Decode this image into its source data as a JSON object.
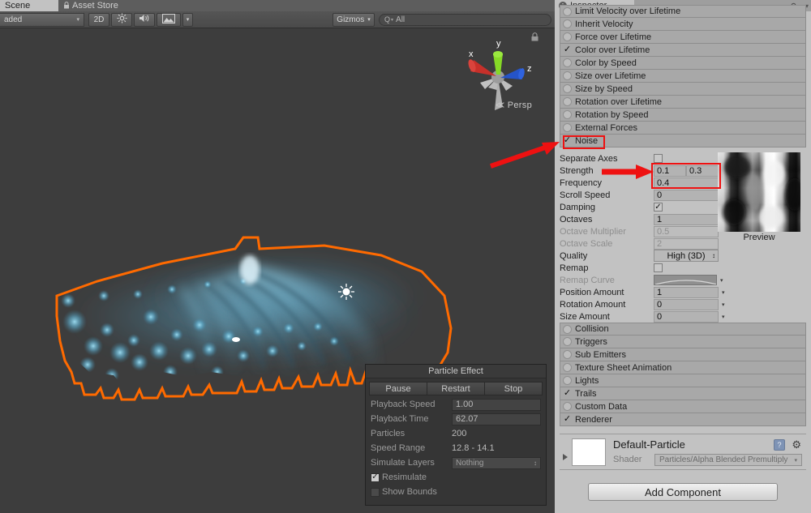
{
  "scene_tabs": [
    {
      "label": "Scene",
      "active": true,
      "icon": ""
    },
    {
      "label": "Asset Store",
      "active": false,
      "icon": "lock-icon"
    }
  ],
  "scene_toolbar": {
    "draw_mode": "aded",
    "mode_2d": "2D",
    "lighting_icon": "sun-icon",
    "audio_icon": "speaker-icon",
    "fx_icon": "image-icon",
    "fx_caret": "▾",
    "gizmos_label": "Gizmos",
    "gizmos_caret": "▾",
    "search_prefix": "Q",
    "search_caret": "▾",
    "search_value": "All",
    "search_placeholder": "All"
  },
  "viewport": {
    "gizmo": {
      "axis_x": "x",
      "axis_y": "y",
      "axis_z": "z",
      "projection": "Persp",
      "projection_arrow": "≪",
      "lock_icon": "lock-icon"
    }
  },
  "particle_effect": {
    "title": "Particle Effect",
    "buttons": [
      "Pause",
      "Restart",
      "Stop"
    ],
    "rows": [
      {
        "label": "Playback Speed",
        "value": "1.00",
        "kind": "field"
      },
      {
        "label": "Playback Time",
        "value": "62.07",
        "kind": "field"
      },
      {
        "label": "Particles",
        "value": "200",
        "kind": "text"
      },
      {
        "label": "Speed Range",
        "value": "12.8 - 14.1",
        "kind": "text"
      },
      {
        "label": "Simulate Layers",
        "value": "Nothing",
        "kind": "dropdown"
      }
    ],
    "checkboxes": [
      {
        "label": "Resimulate",
        "checked": true
      },
      {
        "label": "Show Bounds",
        "checked": false
      }
    ]
  },
  "inspector": {
    "tab_label": "Inspector",
    "info_glyph": "i",
    "lock_icon": "lock-icon",
    "menu_icon": "hamburger-icon",
    "modules_top": [
      {
        "label": "Limit Velocity over Lifetime",
        "checked": false
      },
      {
        "label": "Inherit Velocity",
        "checked": false
      },
      {
        "label": "Force over Lifetime",
        "checked": false
      },
      {
        "label": "Color over Lifetime",
        "checked": true
      },
      {
        "label": "Color by Speed",
        "checked": false
      },
      {
        "label": "Size over Lifetime",
        "checked": false
      },
      {
        "label": "Size by Speed",
        "checked": false
      },
      {
        "label": "Rotation over Lifetime",
        "checked": false
      },
      {
        "label": "Rotation by Speed",
        "checked": false
      },
      {
        "label": "External Forces",
        "checked": false
      },
      {
        "label": "Noise",
        "checked": true
      }
    ],
    "noise": {
      "separate_axes_label": "Separate Axes",
      "separate_axes_checked": false,
      "strength_label": "Strength",
      "strength_min": "0.1",
      "strength_max": "0.3",
      "frequency_label": "Frequency",
      "frequency_value": "0.4",
      "scroll_speed_label": "Scroll Speed",
      "scroll_speed_value": "0",
      "damping_label": "Damping",
      "damping_checked": true,
      "octaves_label": "Octaves",
      "octaves_value": "1",
      "octave_multiplier_label": "Octave Multiplier",
      "octave_multiplier_value": "0.5",
      "octave_scale_label": "Octave Scale",
      "octave_scale_value": "2",
      "quality_label": "Quality",
      "quality_value": "High (3D)",
      "remap_label": "Remap",
      "remap_checked": false,
      "remap_curve_label": "Remap Curve",
      "position_amount_label": "Position Amount",
      "position_amount_value": "1",
      "rotation_amount_label": "Rotation Amount",
      "rotation_amount_value": "0",
      "size_amount_label": "Size Amount",
      "size_amount_value": "0",
      "preview_label": "Preview",
      "caret": "▾",
      "updown": "↕",
      "check": "✓"
    },
    "modules_bottom": [
      {
        "label": "Collision",
        "checked": false
      },
      {
        "label": "Triggers",
        "checked": false
      },
      {
        "label": "Sub Emitters",
        "checked": false
      },
      {
        "label": "Texture Sheet Animation",
        "checked": false
      },
      {
        "label": "Lights",
        "checked": false
      },
      {
        "label": "Trails",
        "checked": true
      },
      {
        "label": "Custom Data",
        "checked": false
      },
      {
        "label": "Renderer",
        "checked": true
      }
    ],
    "material": {
      "name": "Default-Particle",
      "shader_label": "Shader",
      "shader_value": "Particles/Alpha Blended Premultiply",
      "help_icon": "help-book-icon",
      "gear_icon": "gear-icon",
      "caret": "▾"
    },
    "add_component_label": "Add Component"
  },
  "annotations": {
    "accent_color": "#ee1111",
    "boxes": [
      "noise-header-highlight",
      "strength-frequency-highlight"
    ],
    "arrows": [
      "arrow-to-noise-header",
      "arrow-to-strength-field"
    ]
  },
  "colors": {
    "inspector_bg": "#c2c2c2",
    "scene_bg": "#3d3d3d",
    "selection_outline": "#ff6600",
    "particle_blue": "#5fbfe0",
    "toolbar_bg": "#4e4e4e"
  }
}
